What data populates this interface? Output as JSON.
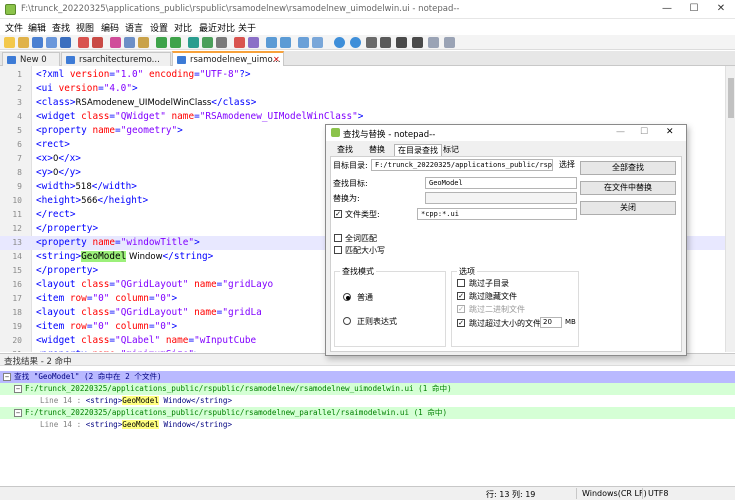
{
  "window": {
    "title": "F:\\trunck_20220325\\applications_public\\rspublic\\rsamodelnew\\rsamodelnew_uimodelwin.ui - notepad--",
    "min_glyph": "—",
    "max_glyph": "☐",
    "close_glyph": "✕"
  },
  "menu": [
    "文件",
    "编辑",
    "查找",
    "视图",
    "编码",
    "语言",
    "设置",
    "对比",
    "最近对比",
    "关于"
  ],
  "tabs": [
    {
      "label": "New 0",
      "close": "",
      "icon_color": "#3d7bd6"
    },
    {
      "label": "rsarchitecturemo...",
      "close": "",
      "icon_color": "#3d7bd6"
    },
    {
      "label": "rsamodelnew_uimo...",
      "close": "✕",
      "icon_color": "#3d7bd6"
    }
  ],
  "editor": {
    "lines": [
      {
        "n": "1",
        "segs": [
          [
            "tag",
            "<?xml "
          ],
          [
            "attr",
            "version"
          ],
          [
            "tag",
            "="
          ],
          [
            "val",
            "\"1.0\""
          ],
          [
            "tag",
            " "
          ],
          [
            "attr",
            "encoding"
          ],
          [
            "tag",
            "="
          ],
          [
            "val",
            "\"UTF-8\""
          ],
          [
            "tag",
            "?>"
          ]
        ]
      },
      {
        "n": "2",
        "segs": [
          [
            "tag",
            "<ui "
          ],
          [
            "attr",
            "version"
          ],
          [
            "tag",
            "="
          ],
          [
            "val",
            "\"4.0\""
          ],
          [
            "tag",
            ">"
          ]
        ]
      },
      {
        "n": "3",
        "segs": [
          [
            "tag",
            " <class>"
          ],
          [
            "txt",
            "RSAmodenew_UIModelWinClass"
          ],
          [
            "tag",
            "</class>"
          ]
        ]
      },
      {
        "n": "4",
        "segs": [
          [
            "tag",
            " <widget "
          ],
          [
            "attr",
            "class"
          ],
          [
            "tag",
            "="
          ],
          [
            "val",
            "\"QWidget\""
          ],
          [
            "tag",
            " "
          ],
          [
            "attr",
            "name"
          ],
          [
            "tag",
            "="
          ],
          [
            "val",
            "\"RSAmodenew_UIModelWinClass\""
          ],
          [
            "tag",
            ">"
          ]
        ]
      },
      {
        "n": "5",
        "segs": [
          [
            "tag",
            "  <property "
          ],
          [
            "attr",
            "name"
          ],
          [
            "tag",
            "="
          ],
          [
            "val",
            "\"geometry\""
          ],
          [
            "tag",
            ">"
          ]
        ]
      },
      {
        "n": "6",
        "segs": [
          [
            "tag",
            "   <rect>"
          ]
        ]
      },
      {
        "n": "7",
        "segs": [
          [
            "tag",
            "    <x>"
          ],
          [
            "txt",
            "0"
          ],
          [
            "tag",
            "</x>"
          ]
        ]
      },
      {
        "n": "8",
        "segs": [
          [
            "tag",
            "    <y>"
          ],
          [
            "txt",
            "0"
          ],
          [
            "tag",
            "</y>"
          ]
        ]
      },
      {
        "n": "9",
        "segs": [
          [
            "tag",
            "    <width>"
          ],
          [
            "txt",
            "518"
          ],
          [
            "tag",
            "</width>"
          ]
        ]
      },
      {
        "n": "10",
        "segs": [
          [
            "tag",
            "    <height>"
          ],
          [
            "txt",
            "566"
          ],
          [
            "tag",
            "</height>"
          ]
        ]
      },
      {
        "n": "11",
        "segs": [
          [
            "tag",
            "   </rect>"
          ]
        ]
      },
      {
        "n": "12",
        "segs": [
          [
            "tag",
            "  </property>"
          ]
        ]
      },
      {
        "n": "13",
        "segs": [
          [
            "tag",
            "  <property "
          ],
          [
            "attr",
            "name"
          ],
          [
            "tag",
            "="
          ],
          [
            "val",
            "\"windowTitle\""
          ],
          [
            "tag",
            ">"
          ]
        ]
      },
      {
        "n": "14",
        "segs": [
          [
            "tag",
            "   <string>"
          ],
          [
            "hl",
            "GeoModel"
          ],
          [
            "txt",
            " Window"
          ],
          [
            "tag",
            "</string>"
          ]
        ]
      },
      {
        "n": "15",
        "segs": [
          [
            "tag",
            "  </property>"
          ]
        ]
      },
      {
        "n": "16",
        "segs": [
          [
            "tag",
            "  <layout "
          ],
          [
            "attr",
            "class"
          ],
          [
            "tag",
            "="
          ],
          [
            "val",
            "\"QGridLayout\""
          ],
          [
            "tag",
            " "
          ],
          [
            "attr",
            "name"
          ],
          [
            "tag",
            "="
          ],
          [
            "val",
            "\"gridLayo"
          ]
        ]
      },
      {
        "n": "17",
        "segs": [
          [
            "tag",
            "   <item "
          ],
          [
            "attr",
            "row"
          ],
          [
            "tag",
            "="
          ],
          [
            "val",
            "\"0\""
          ],
          [
            "tag",
            " "
          ],
          [
            "attr",
            "column"
          ],
          [
            "tag",
            "="
          ],
          [
            "val",
            "\"0\""
          ],
          [
            "tag",
            ">"
          ]
        ]
      },
      {
        "n": "18",
        "segs": [
          [
            "tag",
            "    <layout "
          ],
          [
            "attr",
            "class"
          ],
          [
            "tag",
            "="
          ],
          [
            "val",
            "\"QGridLayout\""
          ],
          [
            "tag",
            " "
          ],
          [
            "attr",
            "name"
          ],
          [
            "tag",
            "="
          ],
          [
            "val",
            "\"gridLa"
          ]
        ]
      },
      {
        "n": "19",
        "segs": [
          [
            "tag",
            "     <item "
          ],
          [
            "attr",
            "row"
          ],
          [
            "tag",
            "="
          ],
          [
            "val",
            "\"0\""
          ],
          [
            "tag",
            " "
          ],
          [
            "attr",
            "column"
          ],
          [
            "tag",
            "="
          ],
          [
            "val",
            "\"0\""
          ],
          [
            "tag",
            ">"
          ]
        ]
      },
      {
        "n": "20",
        "segs": [
          [
            "tag",
            "      <widget "
          ],
          [
            "attr",
            "class"
          ],
          [
            "tag",
            "="
          ],
          [
            "val",
            "\"QLabel\""
          ],
          [
            "tag",
            " "
          ],
          [
            "attr",
            "name"
          ],
          [
            "tag",
            "="
          ],
          [
            "val",
            "\"wInputCube"
          ]
        ]
      },
      {
        "n": "21",
        "segs": [
          [
            "tag",
            "       <property "
          ],
          [
            "attr",
            "name"
          ],
          [
            "tag",
            "="
          ],
          [
            "val",
            "\"minimumSize\""
          ],
          [
            "tag",
            ">"
          ]
        ]
      }
    ]
  },
  "results": {
    "header": "查找结果 - 2 命中",
    "search_line": "查找 \"GeoModel\" (2 命中在 2 个文件)",
    "files": [
      {
        "path": "F:/trunck_20220325/applications_public/rspublic/rsamodelnew/rsamodelnew_uimodelwin.ui (1 命中)",
        "hit_prefix": "Line 14 : ",
        "hit_before": "<string>",
        "hit_word": "GeoModel",
        "hit_after": " Window</string>"
      },
      {
        "path": "F:/trunck_20220325/applications_public/rspublic/rsamodelnew_parallel/rsaimodelwin.ui (1 命中)",
        "hit_prefix": "Line 14 : ",
        "hit_before": "<string>",
        "hit_word": "GeoModel",
        "hit_after": " Window</string>"
      }
    ],
    "fold_minus": "−"
  },
  "status": {
    "position": "行: 13 列: 19",
    "eol": "Windows(CR LF)",
    "encoding": "UTF8"
  },
  "dialog": {
    "title": "查找与替换 - notepad--",
    "tabs": [
      "查找",
      "替换",
      "在目录查找",
      "标记"
    ],
    "active_tab": 2,
    "target_dir_label": "目标目录:",
    "target_dir_value": "F:/trunck_20220325/applications_public/rspublic",
    "browse_button": "选择",
    "find_label": "查找目标:",
    "find_value": "GeoModel",
    "replace_label": "替换为:",
    "replace_value": "",
    "filetype_label": "文件类型:",
    "filetype_value": "*cpp:*.ui",
    "filetype_checked": "✓",
    "whole_word": "全词匹配",
    "match_case": "匹配大小写",
    "mode_group": "查找模式",
    "mode_normal": "普通",
    "mode_regex": "正则表达式",
    "options_group": "选项",
    "opt_skip_subdir": "跳过子目录",
    "opt_skip_hidden": "跳过隐藏文件",
    "opt_skip_binary": "跳过二进制文件",
    "opt_skip_large": "跳过超过大小的文件",
    "size_value": "20",
    "size_unit": "MB",
    "btn_find_all": "全部查找",
    "btn_replace_in_files": "在文件中替换",
    "btn_close": "关闭",
    "check_mark": "✓"
  }
}
